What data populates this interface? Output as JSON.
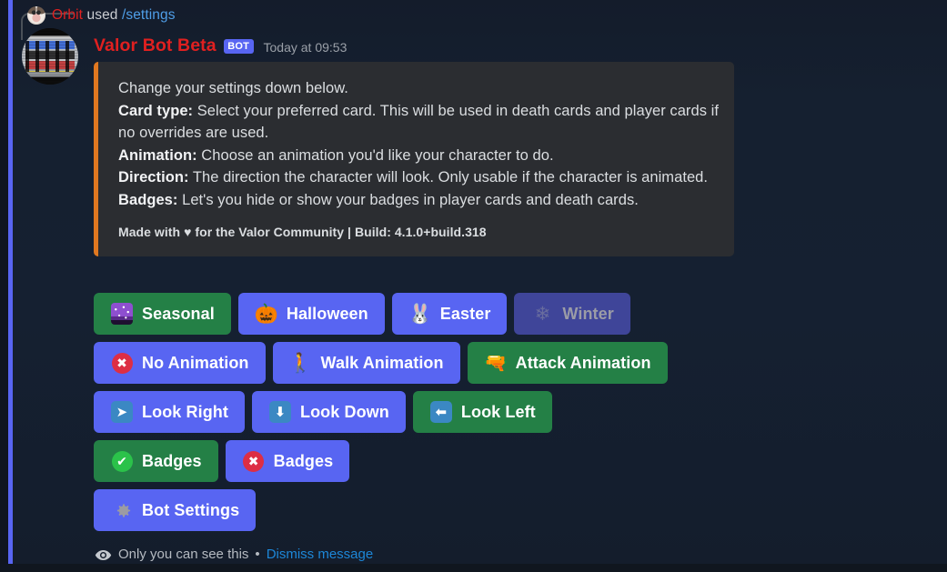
{
  "theme": {
    "background": "#152030",
    "ephemeral_accent": "#5865f2",
    "embed_accent": "#e07820",
    "embed_background": "#2b2d31",
    "primary_button": "#5865f2",
    "success_button": "#248046",
    "disabled_button": "#3f4599",
    "link_color": "#1d87d8",
    "role_color": "#e02020"
  },
  "interaction": {
    "user": "Orbit",
    "used_label": "used",
    "command": "/settings",
    "avatar_icon": "user-avatar"
  },
  "message": {
    "author": "Valor Bot Beta",
    "bot_tag": "BOT",
    "timestamp": "Today at 09:53",
    "avatar_icon": "bot-avatar"
  },
  "embed": {
    "intro": "Change your settings down below.",
    "fields": [
      {
        "label": "Card type:",
        "text": " Select your preferred card. This will be used in death cards and player cards if no overrides are used."
      },
      {
        "label": "Animation:",
        "text": " Choose an animation you'd like your character to do."
      },
      {
        "label": "Direction:",
        "text": " The direction the character will look. Only usable if the character is animated."
      },
      {
        "label": "Badges:",
        "text": " Let's you hide or show your badges in player cards and death cards."
      }
    ],
    "footer_prefix": "Made with ",
    "footer_heart": "♥",
    "footer_suffix": " for the Valor Community | Build: 4.1.0+build.318"
  },
  "action_rows": [
    {
      "row_name": "card-type-row",
      "buttons": [
        {
          "label": "Seasonal",
          "style": "success",
          "emoji_icon": "milky-way-emoji",
          "disabled": false
        },
        {
          "label": "Halloween",
          "style": "primary",
          "emoji_icon": "jack-o-lantern-emoji",
          "emoji_glyph": "🎃",
          "disabled": false
        },
        {
          "label": "Easter",
          "style": "primary",
          "emoji_icon": "rabbit-face-emoji",
          "emoji_glyph": "🐰",
          "disabled": false
        },
        {
          "label": "Winter",
          "style": "disabled",
          "emoji_icon": "snowflake-emoji",
          "emoji_glyph": "❄",
          "disabled": true
        }
      ]
    },
    {
      "row_name": "animation-row",
      "buttons": [
        {
          "label": "No Animation",
          "style": "primary",
          "emoji_icon": "cross-mark-emoji",
          "emoji_glyph": "✖",
          "disabled": false
        },
        {
          "label": "Walk Animation",
          "style": "primary",
          "emoji_icon": "person-walking-emoji",
          "emoji_glyph": "🚶",
          "disabled": false
        },
        {
          "label": "Attack Animation",
          "style": "success",
          "emoji_icon": "water-pistol-emoji",
          "emoji_glyph": "🔫",
          "disabled": false
        }
      ]
    },
    {
      "row_name": "direction-row",
      "buttons": [
        {
          "label": "Look Right",
          "style": "primary",
          "emoji_icon": "arrow-right-emoji",
          "emoji_glyph": "➡",
          "disabled": false
        },
        {
          "label": "Look Down",
          "style": "primary",
          "emoji_icon": "arrow-down-emoji",
          "emoji_glyph": "⬇",
          "disabled": false
        },
        {
          "label": "Look Left",
          "style": "success",
          "emoji_icon": "arrow-left-emoji",
          "emoji_glyph": "⬅",
          "disabled": false
        }
      ]
    },
    {
      "row_name": "badges-row",
      "buttons": [
        {
          "label": "Badges",
          "style": "success",
          "emoji_icon": "check-mark-emoji",
          "emoji_glyph": "✔",
          "disabled": false
        },
        {
          "label": "Badges",
          "style": "primary",
          "emoji_icon": "cross-mark-emoji",
          "emoji_glyph": "✖",
          "disabled": false
        }
      ]
    },
    {
      "row_name": "bot-settings-row",
      "buttons": [
        {
          "label": "Bot Settings",
          "style": "primary",
          "emoji_icon": "gear-emoji",
          "emoji_glyph": "⚙",
          "disabled": false
        }
      ]
    }
  ],
  "ephemeral": {
    "icon": "eye-icon",
    "text": "Only you can see this",
    "separator": "•",
    "dismiss_label": "Dismiss message"
  }
}
